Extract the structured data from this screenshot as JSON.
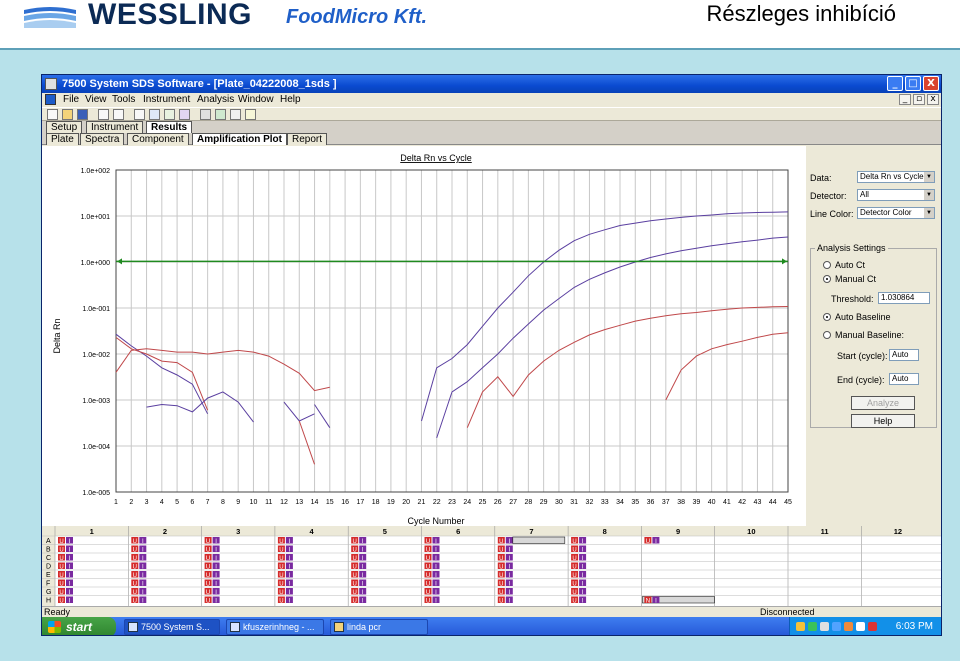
{
  "slide": {
    "logo": "WESSLING",
    "brand_sub": "FoodMicro Kft.",
    "title": "Részleges inhibíció"
  },
  "window": {
    "title": "7500 System SDS Software - [Plate_04222008_1sds ]",
    "controls": [
      "_",
      "□",
      "X"
    ],
    "mdi_controls": [
      "_",
      "▫",
      "x"
    ]
  },
  "menu": [
    "File",
    "View",
    "Tools",
    "Instrument",
    "Analysis",
    "Window",
    "Help"
  ],
  "tabs_top": [
    {
      "label": "Setup",
      "active": false
    },
    {
      "label": "Instrument",
      "active": false
    },
    {
      "label": "Results",
      "active": true
    }
  ],
  "tabs_sub": [
    {
      "label": "Plate",
      "active": false
    },
    {
      "label": "Spectra",
      "active": false
    },
    {
      "label": "Component",
      "active": false
    },
    {
      "label": "Amplification Plot",
      "active": true
    },
    {
      "label": "Report",
      "active": false
    }
  ],
  "chart_data": {
    "type": "line",
    "title": "Delta Rn vs Cycle",
    "xlabel": "Cycle Number",
    "ylabel": "Delta Rn",
    "x_ticks": [
      1,
      2,
      3,
      4,
      5,
      6,
      7,
      8,
      9,
      10,
      11,
      12,
      13,
      14,
      15,
      16,
      17,
      18,
      19,
      20,
      21,
      22,
      23,
      24,
      25,
      26,
      27,
      28,
      29,
      30,
      31,
      32,
      33,
      34,
      35,
      36,
      37,
      38,
      39,
      40,
      41,
      42,
      43,
      44,
      45
    ],
    "y_scale": "log",
    "y_ticks": [
      "1.0e+002",
      "1.0e+001",
      "1.0e+000",
      "1.0e-001",
      "1.0e-002",
      "1.0e-003",
      "1.0e-004",
      "1.0e-005"
    ],
    "ylim": [
      1e-05,
      100
    ],
    "xlim": [
      1,
      45
    ],
    "grid": true,
    "threshold": 1.030864,
    "series": [
      {
        "color": "#5a3fa0",
        "points": [
          [
            1,
            0.027
          ],
          [
            2,
            0.015
          ],
          [
            3,
            0.009
          ],
          [
            4,
            0.005
          ],
          [
            5,
            0.0035
          ],
          [
            6,
            0.0022
          ],
          [
            7,
            0.0005
          ]
        ]
      },
      {
        "color": "#c0484a",
        "points": [
          [
            1,
            0.023
          ],
          [
            2,
            0.013
          ],
          [
            3,
            0.01
          ],
          [
            4,
            0.007
          ],
          [
            5,
            0.0065
          ],
          [
            6,
            0.004
          ],
          [
            7,
            0.0006
          ]
        ]
      },
      {
        "color": "#c0484a",
        "points": [
          [
            1,
            0.004
          ],
          [
            2,
            0.012
          ],
          [
            3,
            0.013
          ],
          [
            4,
            0.012
          ],
          [
            5,
            0.011
          ],
          [
            6,
            0.011
          ],
          [
            7,
            0.01
          ],
          [
            8,
            0.011
          ],
          [
            9,
            0.012
          ],
          [
            10,
            0.011
          ],
          [
            11,
            0.009
          ],
          [
            12,
            0.006
          ],
          [
            13,
            0.0038
          ],
          [
            14,
            0.0016
          ],
          [
            15,
            0.0019
          ]
        ]
      },
      {
        "color": "#5a3fa0",
        "points": [
          [
            3,
            0.0007
          ],
          [
            4,
            0.0008
          ],
          [
            5,
            0.00075
          ],
          [
            6,
            0.00055
          ],
          [
            7,
            0.0011
          ],
          [
            8,
            0.0015
          ],
          [
            9,
            0.0009
          ],
          [
            10,
            0.00033
          ]
        ]
      },
      {
        "color": "#5a3fa0",
        "points": [
          [
            12,
            0.0009
          ],
          [
            13,
            0.00035
          ],
          [
            14,
            0.0005
          ]
        ]
      },
      {
        "color": "#5a3fa0",
        "points": [
          [
            14,
            0.0008
          ],
          [
            15,
            0.00025
          ]
        ]
      },
      {
        "color": "#c0484a",
        "points": [
          [
            13,
            0.00035
          ],
          [
            14,
            4e-05
          ]
        ]
      },
      {
        "color": "#5a3fa0",
        "points": [
          [
            21,
            0.00035
          ],
          [
            22,
            0.005
          ],
          [
            23,
            0.008
          ],
          [
            24,
            0.016
          ],
          [
            25,
            0.04
          ],
          [
            26,
            0.1
          ],
          [
            27,
            0.22
          ],
          [
            28,
            0.5
          ],
          [
            29,
            1.0
          ],
          [
            30,
            1.8
          ],
          [
            31,
            2.9
          ],
          [
            32,
            4.0
          ],
          [
            33,
            5.0
          ],
          [
            34,
            6.2
          ],
          [
            35,
            7.0
          ],
          [
            36,
            7.9
          ],
          [
            37,
            8.6
          ],
          [
            38,
            9.3
          ],
          [
            39,
            10.0
          ],
          [
            40,
            10.5
          ],
          [
            41,
            11.2
          ],
          [
            42,
            11.6
          ],
          [
            43,
            11.9
          ],
          [
            44,
            12.1
          ],
          [
            45,
            12.3
          ]
        ]
      },
      {
        "color": "#5a3fa0",
        "points": [
          [
            22,
            0.00015
          ],
          [
            23,
            0.0015
          ],
          [
            24,
            0.0025
          ],
          [
            25,
            0.005
          ],
          [
            26,
            0.01
          ],
          [
            27,
            0.022
          ],
          [
            28,
            0.045
          ],
          [
            29,
            0.09
          ],
          [
            30,
            0.16
          ],
          [
            31,
            0.28
          ],
          [
            32,
            0.42
          ],
          [
            33,
            0.58
          ],
          [
            34,
            0.78
          ],
          [
            35,
            1.0
          ],
          [
            36,
            1.25
          ],
          [
            37,
            1.5
          ],
          [
            38,
            1.75
          ],
          [
            39,
            2.0
          ],
          [
            40,
            2.25
          ],
          [
            41,
            2.5
          ],
          [
            42,
            2.75
          ],
          [
            43,
            3.0
          ],
          [
            44,
            3.3
          ],
          [
            45,
            3.5
          ]
        ]
      },
      {
        "color": "#c0484a",
        "points": [
          [
            24,
            0.00025
          ],
          [
            25,
            0.0015
          ],
          [
            26,
            0.0032
          ],
          [
            27,
            0.0012
          ],
          [
            28,
            0.0035
          ],
          [
            29,
            0.007
          ],
          [
            30,
            0.012
          ],
          [
            31,
            0.018
          ],
          [
            32,
            0.026
          ],
          [
            33,
            0.034
          ],
          [
            34,
            0.042
          ],
          [
            35,
            0.052
          ],
          [
            36,
            0.06
          ],
          [
            37,
            0.068
          ],
          [
            38,
            0.075
          ],
          [
            39,
            0.08
          ],
          [
            40,
            0.087
          ],
          [
            41,
            0.094
          ],
          [
            42,
            0.1
          ],
          [
            43,
            0.103
          ],
          [
            44,
            0.106
          ],
          [
            45,
            0.108
          ]
        ]
      },
      {
        "color": "#c0484a",
        "points": [
          [
            37,
            0.001
          ],
          [
            38,
            0.0045
          ],
          [
            39,
            0.009
          ],
          [
            40,
            0.013
          ],
          [
            41,
            0.016
          ],
          [
            42,
            0.019
          ],
          [
            43,
            0.023
          ],
          [
            44,
            0.027
          ],
          [
            45,
            0.029
          ]
        ]
      }
    ]
  },
  "side": {
    "data_label": "Data:",
    "data_value": "Delta Rn vs Cycle",
    "detector_label": "Detector:",
    "detector_value": "All",
    "linecolor_label": "Line Color:",
    "linecolor_value": "Detector Color",
    "analysis_title": "Analysis Settings",
    "auto_ct": "Auto Ct",
    "manual_ct": "Manual Ct",
    "threshold_label": "Threshold:",
    "threshold_value": "1.030864",
    "auto_baseline": "Auto Baseline",
    "manual_baseline": "Manual Baseline:",
    "start_label": "Start (cycle):",
    "start_value": "Auto",
    "end_label": "End (cycle):",
    "end_value": "Auto",
    "analyze_btn": "Analyze",
    "help_btn": "Help"
  },
  "plate": {
    "columns": [
      "1",
      "2",
      "3",
      "4",
      "5",
      "6",
      "7",
      "8",
      "9",
      "10",
      "11",
      "12"
    ],
    "rows": [
      "A",
      "B",
      "C",
      "D",
      "E",
      "F",
      "G",
      "H"
    ],
    "well_u": "U",
    "well_i": "I",
    "well_n": "N"
  },
  "status": {
    "left": "Ready",
    "right": "Disconnected"
  },
  "taskbar": {
    "start": "start",
    "tasks": [
      "7500 System S...",
      "kfuszerinhneg - ...",
      "linda pcr"
    ],
    "clock": "6:03 PM"
  }
}
